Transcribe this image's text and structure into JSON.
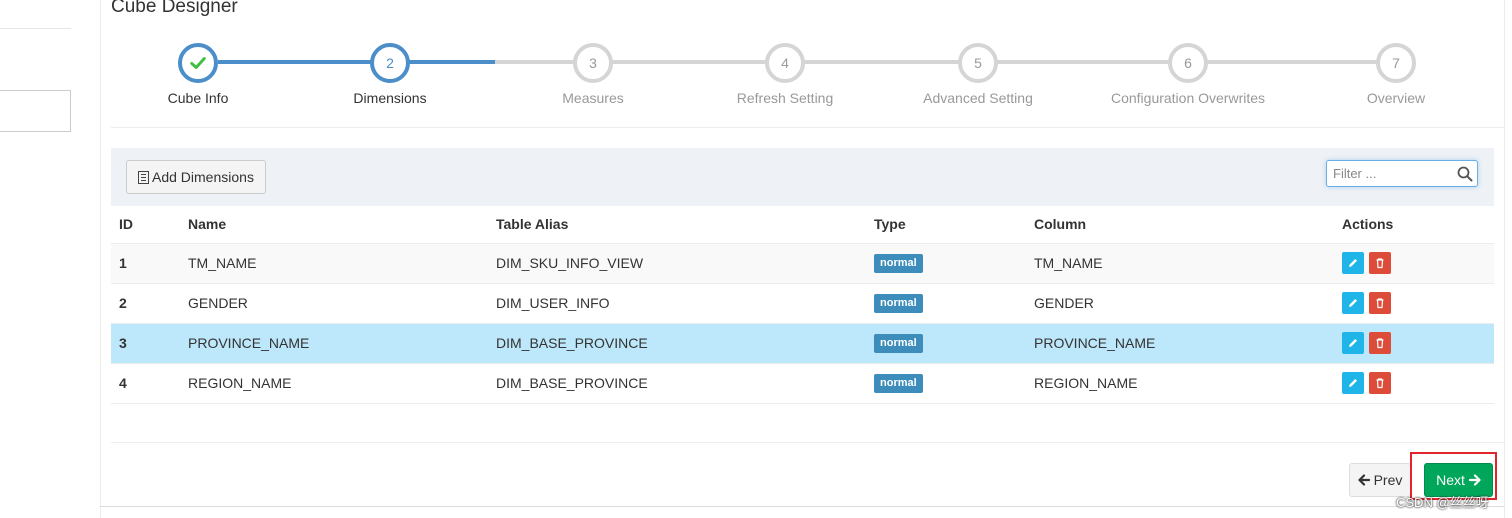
{
  "title": "Cube Designer",
  "steps": [
    {
      "num": "✓",
      "label": "Cube Info",
      "state": "done"
    },
    {
      "num": "2",
      "label": "Dimensions",
      "state": "current"
    },
    {
      "num": "3",
      "label": "Measures",
      "state": "todo"
    },
    {
      "num": "4",
      "label": "Refresh Setting",
      "state": "todo"
    },
    {
      "num": "5",
      "label": "Advanced Setting",
      "state": "todo"
    },
    {
      "num": "6",
      "label": "Configuration Overwrites",
      "state": "todo"
    },
    {
      "num": "7",
      "label": "Overview",
      "state": "todo"
    }
  ],
  "toolbar": {
    "add_label": "Add Dimensions",
    "filter_placeholder": "Filter ..."
  },
  "table": {
    "headers": [
      "ID",
      "Name",
      "Table Alias",
      "Type",
      "Column",
      "Actions"
    ],
    "rows": [
      {
        "id": "1",
        "name": "TM_NAME",
        "alias": "DIM_SKU_INFO_VIEW",
        "type": "normal",
        "column": "TM_NAME"
      },
      {
        "id": "2",
        "name": "GENDER",
        "alias": "DIM_USER_INFO",
        "type": "normal",
        "column": "GENDER"
      },
      {
        "id": "3",
        "name": "PROVINCE_NAME",
        "alias": "DIM_BASE_PROVINCE",
        "type": "normal",
        "column": "PROVINCE_NAME"
      },
      {
        "id": "4",
        "name": "REGION_NAME",
        "alias": "DIM_BASE_PROVINCE",
        "type": "normal",
        "column": "REGION_NAME"
      }
    ],
    "selected_row_id": "3"
  },
  "footer": {
    "prev_label": "Prev",
    "next_label": "Next"
  },
  "watermark": "CSDN @丝丝呀",
  "colors": {
    "accent": "#4b8ec9",
    "badge": "#3c8dbc",
    "edit": "#1fb5e8",
    "delete": "#dd4b39",
    "next": "#00a65a",
    "selected_row": "#bde7fa",
    "highlight": "#e0262b"
  }
}
